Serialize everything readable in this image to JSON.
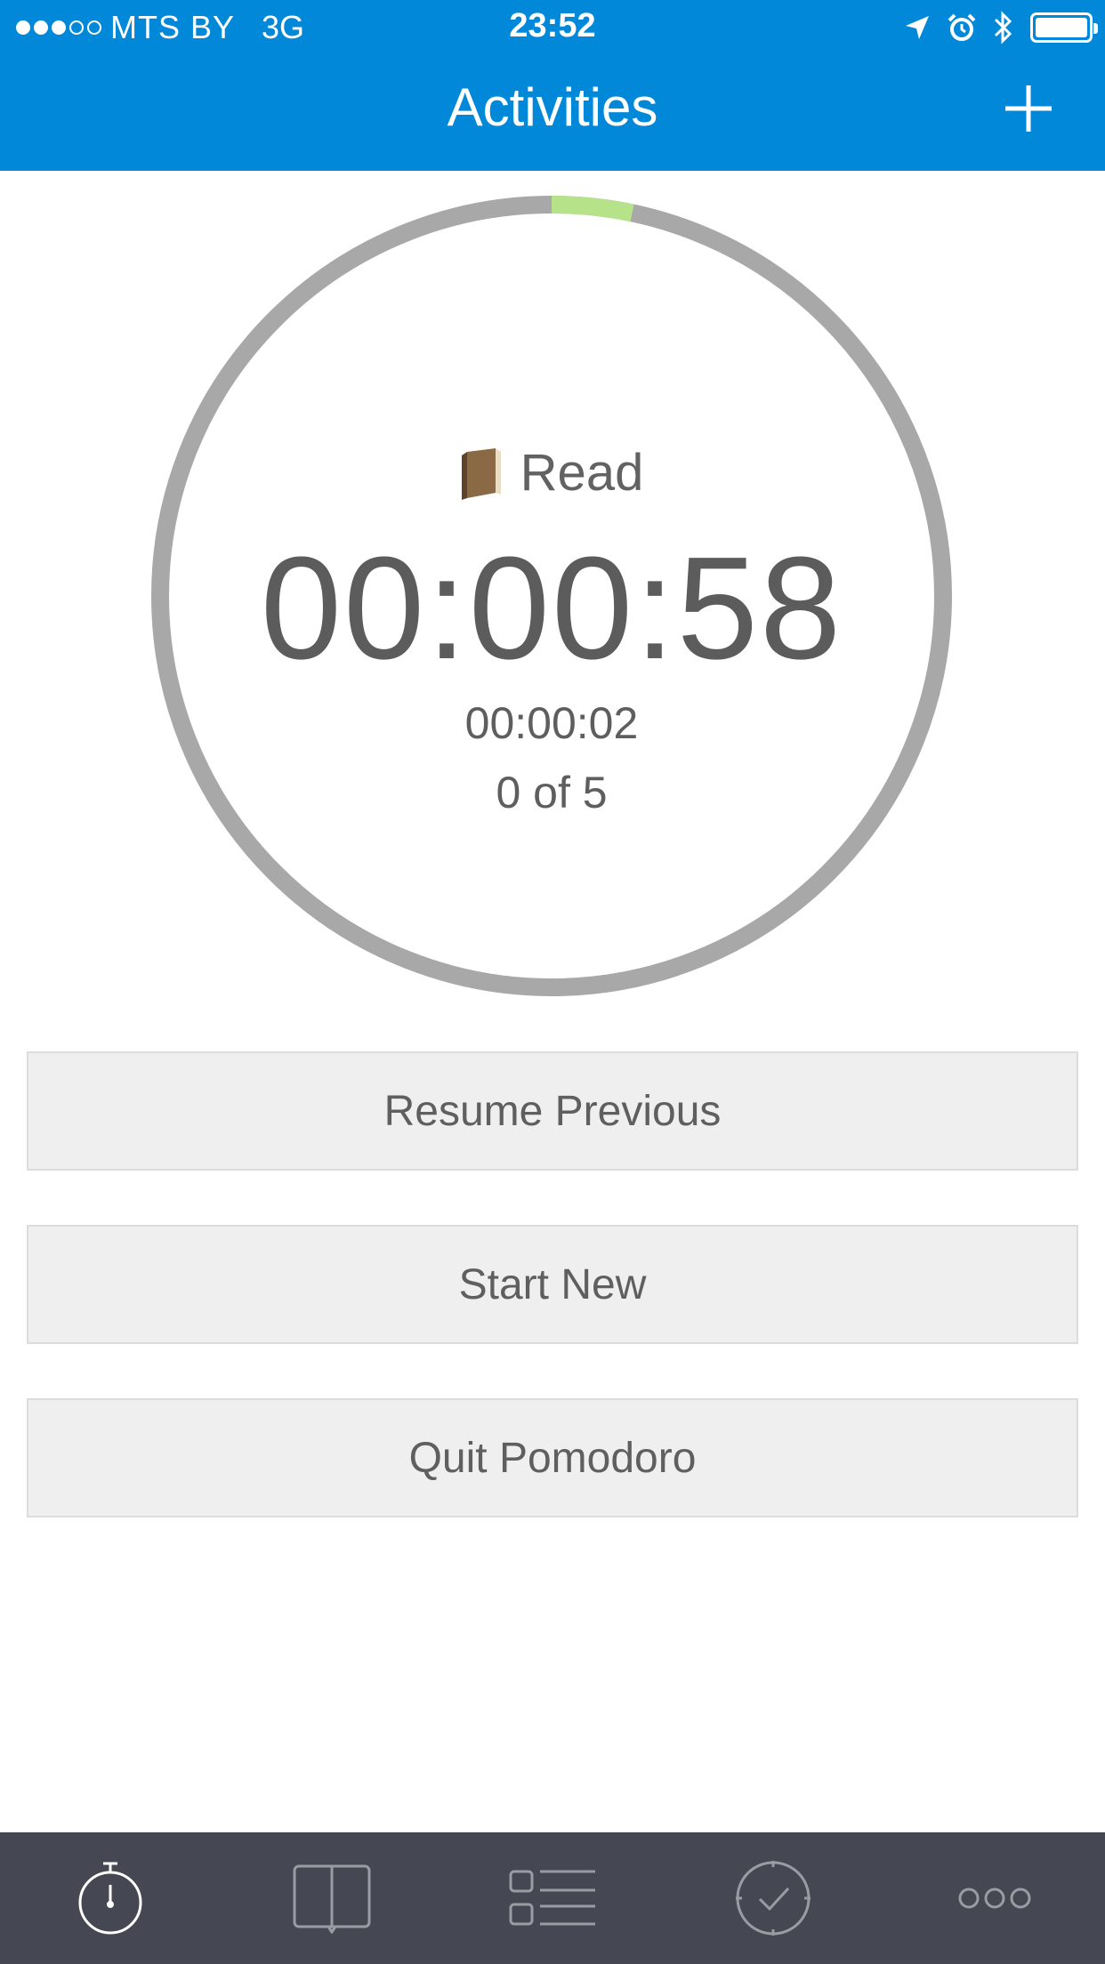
{
  "status_bar": {
    "signal_bars_filled": 3,
    "signal_bars_total": 5,
    "carrier": "MTS BY",
    "network": "3G",
    "time": "23:52",
    "icons": [
      "location-arrow-icon",
      "alarm-icon",
      "bluetooth-icon",
      "battery-icon"
    ]
  },
  "nav": {
    "title": "Activities",
    "add_icon": "plus-icon"
  },
  "timer": {
    "activity_icon": "book-icon",
    "activity_name": "Read",
    "elapsed": "00:00:58",
    "secondary": "00:00:02",
    "progress_label": "0 of 5",
    "progress_fraction": 0.033,
    "colors": {
      "ring_track": "#a8a8a8",
      "ring_progress": "#b6e28a"
    }
  },
  "buttons": {
    "resume": "Resume Previous",
    "start_new": "Start New",
    "quit": "Quit Pomodoro"
  },
  "tab_bar": {
    "tabs": [
      {
        "icon": "stopwatch-icon",
        "active": true
      },
      {
        "icon": "book-icon",
        "active": false
      },
      {
        "icon": "list-icon",
        "active": false
      },
      {
        "icon": "check-clock-icon",
        "active": false
      },
      {
        "icon": "more-icon",
        "active": false
      }
    ],
    "colors": {
      "background": "#454852",
      "active": "#ffffff",
      "inactive": "#9a9ca4"
    }
  },
  "colors": {
    "accent": "#0288d8"
  }
}
